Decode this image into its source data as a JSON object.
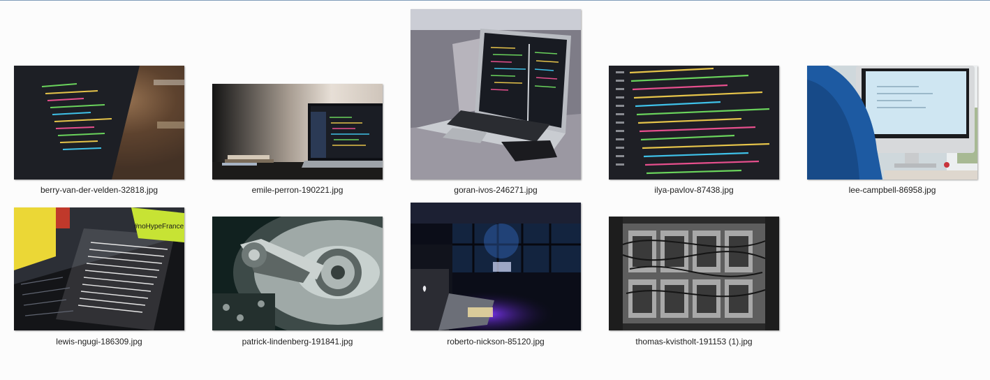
{
  "files": [
    {
      "id": "berry",
      "name": "berry-van-der-velden-32818.jpg"
    },
    {
      "id": "emile",
      "name": "emile-perron-190221.jpg"
    },
    {
      "id": "goran",
      "name": "goran-ivos-246271.jpg"
    },
    {
      "id": "ilya",
      "name": "ilya-pavlov-87438.jpg"
    },
    {
      "id": "lee",
      "name": "lee-campbell-86958.jpg"
    },
    {
      "id": "lewis",
      "name": "lewis-ngugi-186309.jpg",
      "sticker_text": "#noHypeFrance"
    },
    {
      "id": "patrick",
      "name": "patrick-lindenberg-191841.jpg"
    },
    {
      "id": "roberto",
      "name": "roberto-nickson-85120.jpg"
    },
    {
      "id": "thomas",
      "name": "thomas-kvistholt-191153 (1).jpg"
    }
  ]
}
